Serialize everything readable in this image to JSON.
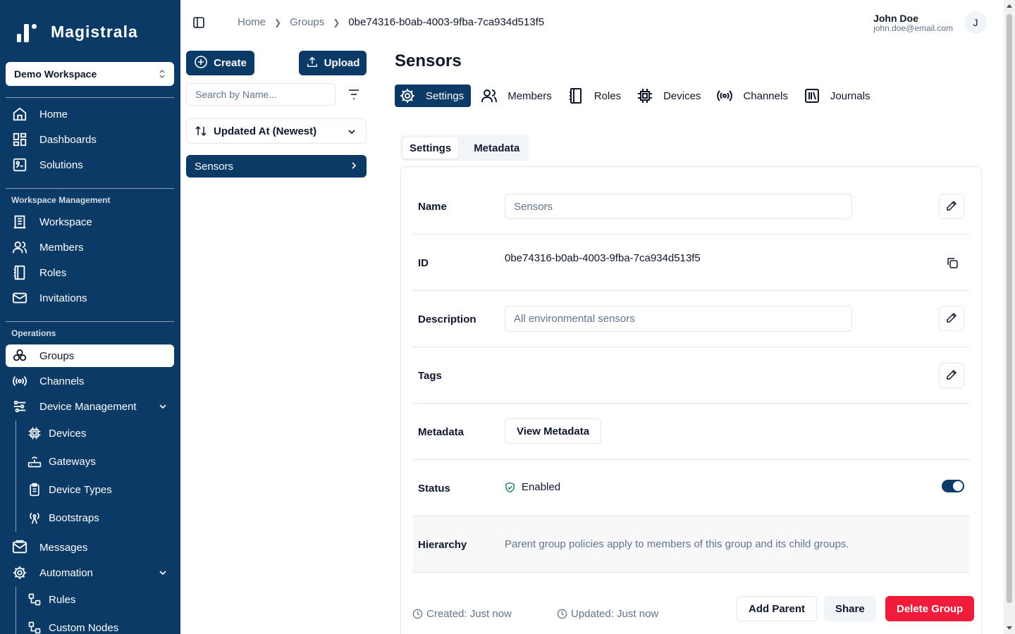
{
  "app": {
    "brand_name": "Magistrala"
  },
  "colors": {
    "sidebar_bg": "#0b3a66",
    "accent": "#0b3a66",
    "danger": "#ef1d3a",
    "muted_text": "#64748b"
  },
  "sidebar": {
    "workspace_selector": "Demo Workspace",
    "main_items": [
      {
        "label": "Home",
        "icon": "home-icon"
      },
      {
        "label": "Dashboards",
        "icon": "dashboard-icon"
      },
      {
        "label": "Solutions",
        "icon": "solutions-icon"
      }
    ],
    "workspace_management_label": "Workspace Management",
    "workspace_items": [
      {
        "label": "Workspace",
        "icon": "building-icon"
      },
      {
        "label": "Members",
        "icon": "users-icon"
      },
      {
        "label": "Roles",
        "icon": "book-icon"
      },
      {
        "label": "Invitations",
        "icon": "mail-icon"
      }
    ],
    "operations_label": "Operations",
    "operations_items": [
      {
        "label": "Groups",
        "icon": "groups-icon",
        "active": true
      },
      {
        "label": "Channels",
        "icon": "broadcast-icon"
      },
      {
        "label": "Device Management",
        "icon": "sliders-icon"
      }
    ],
    "device_management_items": [
      {
        "label": "Devices",
        "icon": "chip-icon"
      },
      {
        "label": "Gateways",
        "icon": "router-icon"
      },
      {
        "label": "Device Types",
        "icon": "clipboard-icon"
      },
      {
        "label": "Bootstraps",
        "icon": "antenna-icon"
      }
    ],
    "bottom_items": [
      {
        "label": "Messages",
        "icon": "mail-open-icon"
      },
      {
        "label": "Automation",
        "icon": "gear-icon"
      }
    ],
    "automation_items": [
      {
        "label": "Rules",
        "icon": "workflow-icon"
      },
      {
        "label": "Custom Nodes",
        "icon": "nodes-icon"
      }
    ]
  },
  "header": {
    "breadcrumb": [
      "Home",
      "Groups",
      "0be74316-b0ab-4003-9fba-7ca934d513f5"
    ],
    "user_name": "John Doe",
    "user_email": "john.doe@email.com",
    "avatar_initial": "J"
  },
  "list_panel": {
    "create_label": "Create",
    "upload_label": "Upload",
    "search_placeholder": "Search by Name...",
    "sort_value": "Updated At (Newest)",
    "items": [
      "Sensors"
    ]
  },
  "main": {
    "title": "Sensors",
    "tabs": [
      {
        "label": "Settings",
        "icon": "gear-icon",
        "active": true
      },
      {
        "label": "Members",
        "icon": "users-icon"
      },
      {
        "label": "Roles",
        "icon": "book-icon"
      },
      {
        "label": "Devices",
        "icon": "chip-icon"
      },
      {
        "label": "Channels",
        "icon": "broadcast-icon"
      },
      {
        "label": "Journals",
        "icon": "library-icon"
      }
    ],
    "subtabs": [
      "Settings",
      "Metadata"
    ],
    "fields": {
      "name_label": "Name",
      "name_value": "Sensors",
      "id_label": "ID",
      "id_value": "0be74316-b0ab-4003-9fba-7ca934d513f5",
      "description_label": "Description",
      "description_value": "All environmental sensors",
      "tags_label": "Tags",
      "metadata_label": "Metadata",
      "view_metadata_label": "View Metadata",
      "status_label": "Status",
      "status_value": "Enabled",
      "status_enabled": true,
      "hierarchy_label": "Hierarchy",
      "hierarchy_text": "Parent group policies apply to members of this group and its child groups."
    },
    "footer": {
      "created": "Created: Just now",
      "updated": "Updated: Just now",
      "add_parent_label": "Add Parent",
      "share_label": "Share",
      "delete_label": "Delete Group"
    }
  }
}
